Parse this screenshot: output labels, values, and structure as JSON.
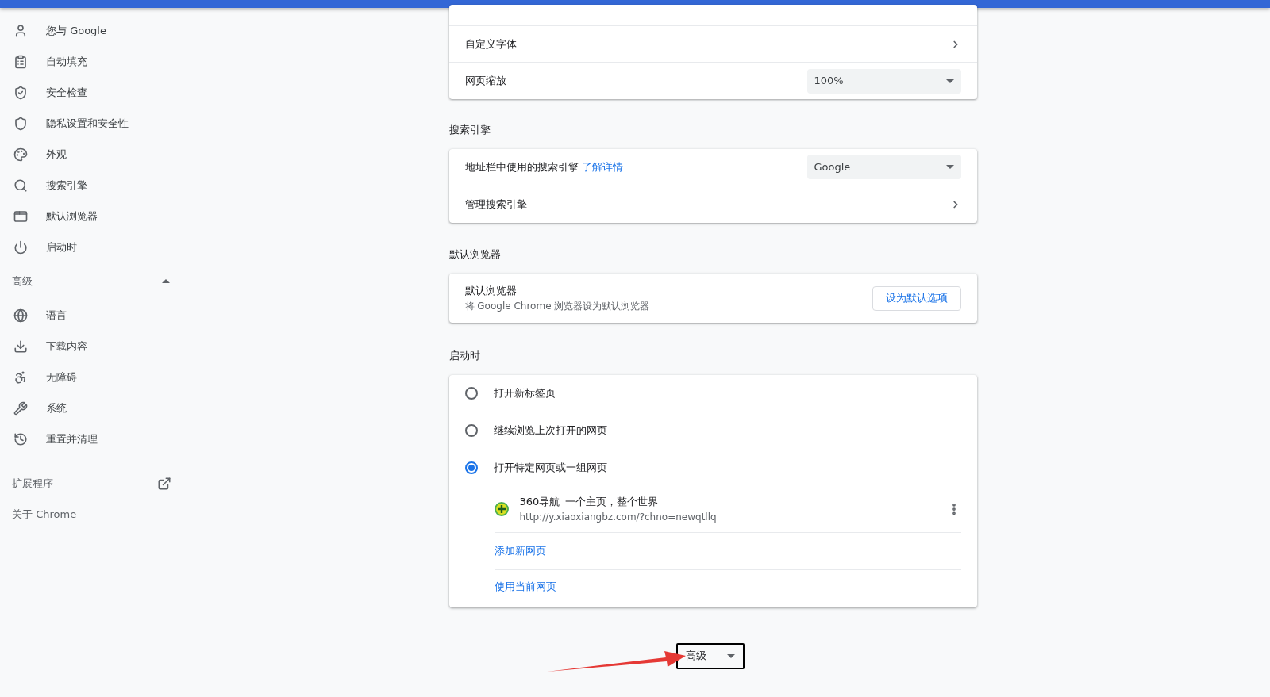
{
  "sidebar": {
    "items": [
      {
        "label": "您与 Google"
      },
      {
        "label": "自动填充"
      },
      {
        "label": "安全检查"
      },
      {
        "label": "隐私设置和安全性"
      },
      {
        "label": "外观"
      },
      {
        "label": "搜索引擎"
      },
      {
        "label": "默认浏览器"
      },
      {
        "label": "启动时"
      }
    ],
    "advanced": {
      "label": "高级",
      "expanded": true,
      "items": [
        {
          "label": "语言"
        },
        {
          "label": "下载内容"
        },
        {
          "label": "无障碍"
        },
        {
          "label": "系统"
        },
        {
          "label": "重置并清理"
        }
      ]
    },
    "extensions": "扩展程序",
    "about": "关于 Chrome"
  },
  "appearance_card": {
    "custom_fonts": "自定义字体",
    "zoom_label": "网页缩放",
    "zoom_value": "100%"
  },
  "search_engine": {
    "heading": "搜索引擎",
    "engine_label": "地址栏中使用的搜索引擎",
    "learn_more": "了解详情",
    "engine_value": "Google",
    "manage": "管理搜索引擎"
  },
  "default_browser": {
    "heading": "默认浏览器",
    "title": "默认浏览器",
    "subtitle": "将 Google Chrome 浏览器设为默认浏览器",
    "button": "设为默认选项"
  },
  "on_startup": {
    "heading": "启动时",
    "options": [
      {
        "label": "打开新标签页",
        "selected": false
      },
      {
        "label": "继续浏览上次打开的网页",
        "selected": false
      },
      {
        "label": "打开特定网页或一组网页",
        "selected": true
      }
    ],
    "pages": [
      {
        "title": "360导航_一个主页，整个世界",
        "url": "http://y.xiaoxiangbz.com/?chno=newqtllq"
      }
    ],
    "add_page": "添加新网页",
    "use_current": "使用当前网页"
  },
  "advanced_button": {
    "label": "高级",
    "expanded": false
  }
}
